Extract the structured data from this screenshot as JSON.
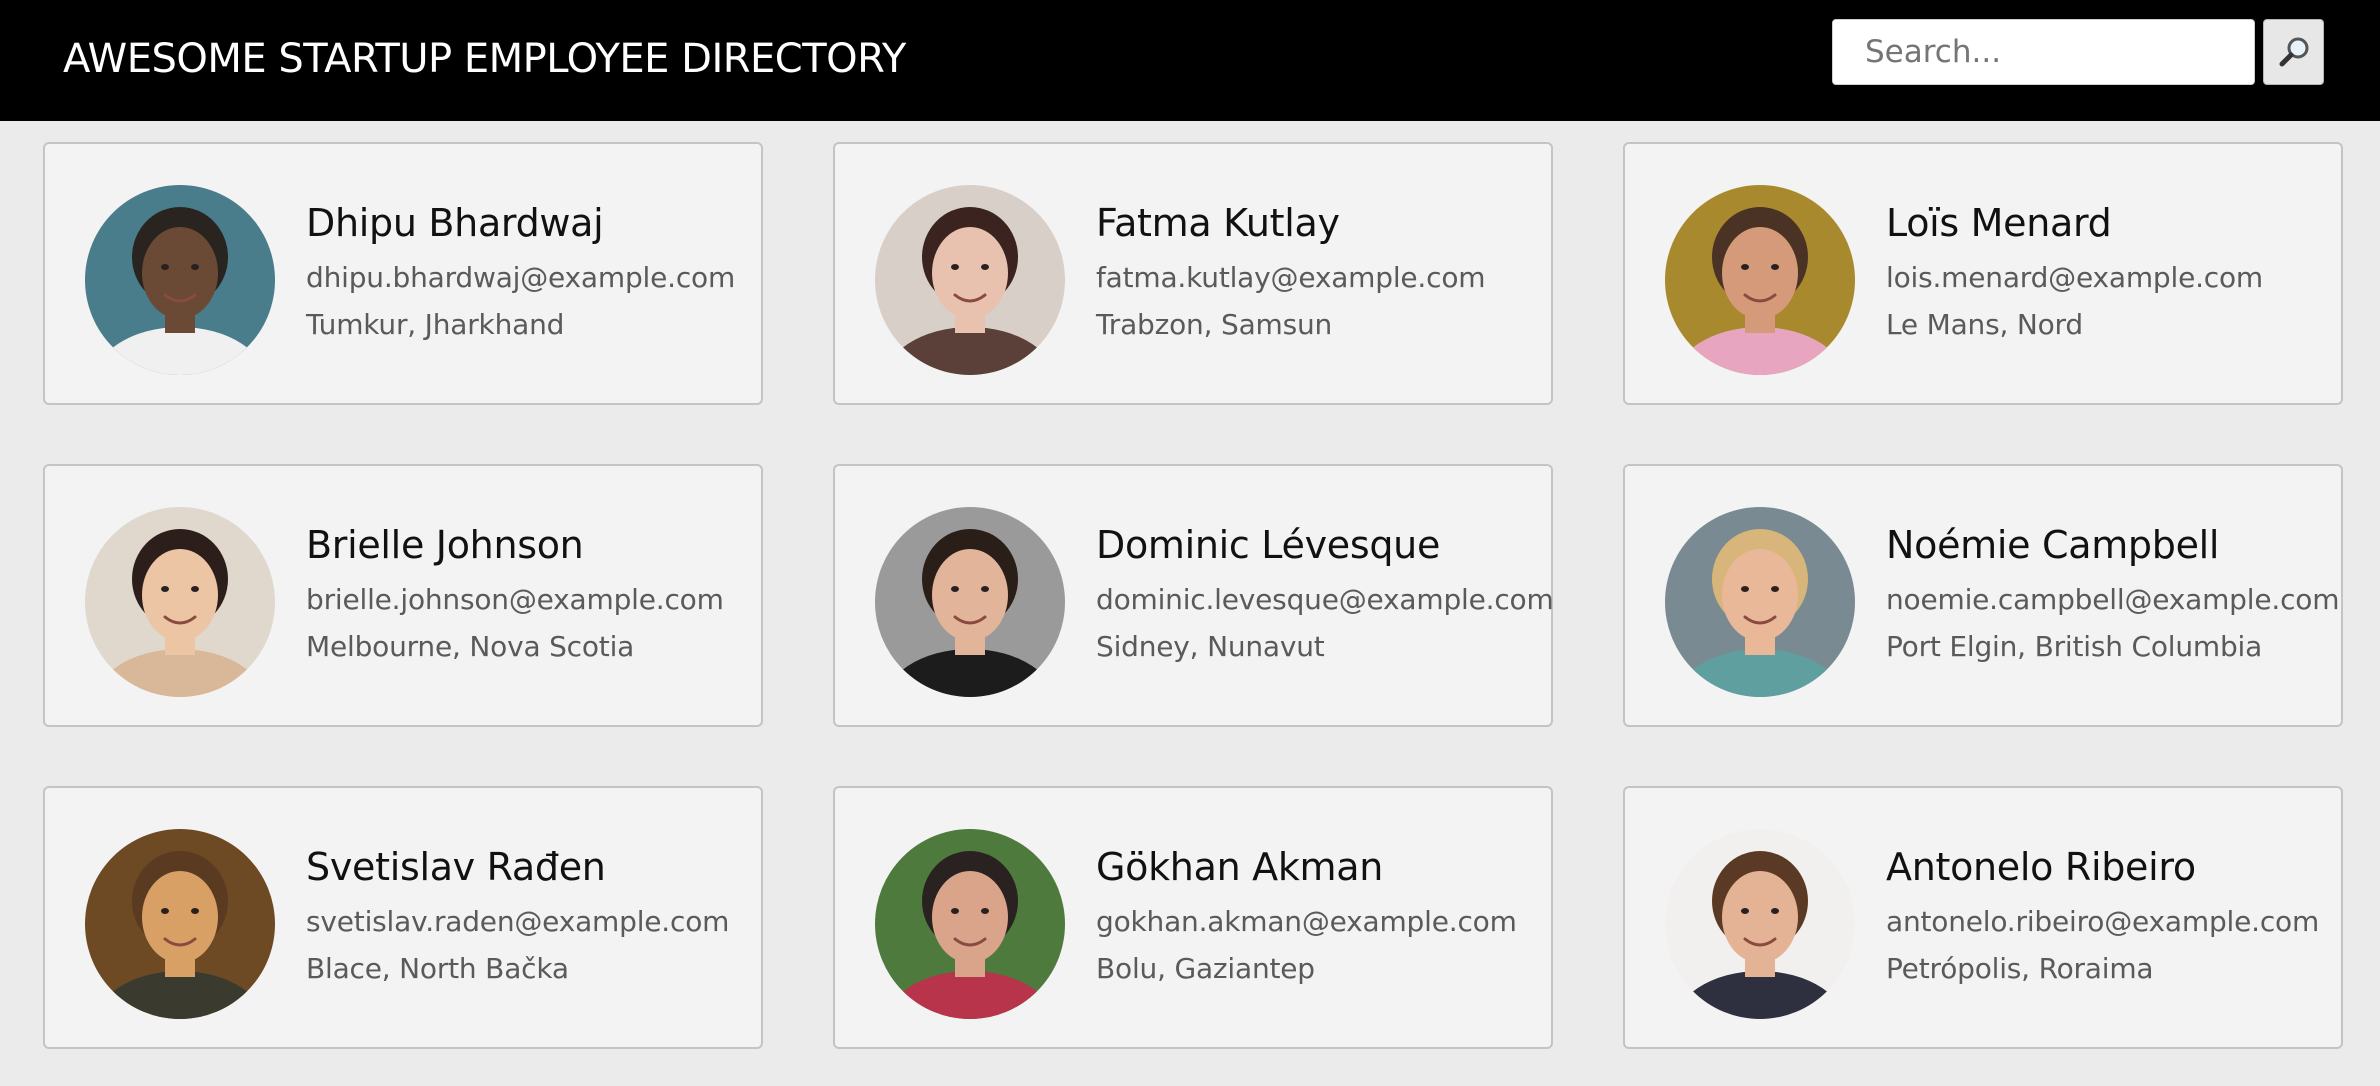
{
  "header": {
    "title": "AWESOME STARTUP EMPLOYEE DIRECTORY",
    "search_placeholder": "Search...",
    "search_icon": "magnifier-icon"
  },
  "employees": [
    {
      "name": "Dhipu Bhardwaj",
      "email": "dhipu.bhardwaj@example.com",
      "location": "Tumkur, Jharkhand",
      "bg": "#4a7d8c",
      "skin": "#6b4a35",
      "hair": "#2a2420",
      "shirt": "#f0f0f0"
    },
    {
      "name": "Fatma Kutlay",
      "email": "fatma.kutlay@example.com",
      "location": "Trabzon, Samsun",
      "bg": "#d9cfc9",
      "skin": "#e8c2ae",
      "hair": "#3b2420",
      "shirt": "#5a4038"
    },
    {
      "name": "Loïs Menard",
      "email": "lois.menard@example.com",
      "location": "Le Mans, Nord",
      "bg": "#a8892e",
      "skin": "#d49a7a",
      "hair": "#4a3325",
      "shirt": "#e7a5c0"
    },
    {
      "name": "Brielle Johnson",
      "email": "brielle.johnson@example.com",
      "location": "Melbourne, Nova Scotia",
      "bg": "#e0d8cd",
      "skin": "#ecc6a4",
      "hair": "#2b1e1b",
      "shirt": "#d9b89a"
    },
    {
      "name": "Dominic Lévesque",
      "email": "dominic.levesque@example.com",
      "location": "Sidney, Nunavut",
      "bg": "#9a9a9a",
      "skin": "#e2b59a",
      "hair": "#2a1e18",
      "shirt": "#1c1c1c"
    },
    {
      "name": "Noémie Campbell",
      "email": "noemie.campbell@example.com",
      "location": "Port Elgin, British Columbia",
      "bg": "#7a8a92",
      "skin": "#e8b898",
      "hair": "#d8b57a",
      "shirt": "#5f9fa0"
    },
    {
      "name": "Svetislav Rađen",
      "email": "svetislav.raden@example.com",
      "location": "Blace, North Bačka",
      "bg": "#6e4a24",
      "skin": "#d9a066",
      "hair": "#5a3a20",
      "shirt": "#3a3a2e"
    },
    {
      "name": "Gökhan Akman",
      "email": "gokhan.akman@example.com",
      "location": "Bolu, Gaziantep",
      "bg": "#4f7a3e",
      "skin": "#d9a48a",
      "hair": "#2a2220",
      "shirt": "#b8344a"
    },
    {
      "name": "Antonelo Ribeiro",
      "email": "antonelo.ribeiro@example.com",
      "location": "Petrópolis, Roraima",
      "bg": "#f2f0ee",
      "skin": "#e4b396",
      "hair": "#5a3a24",
      "shirt": "#2e3040"
    }
  ]
}
